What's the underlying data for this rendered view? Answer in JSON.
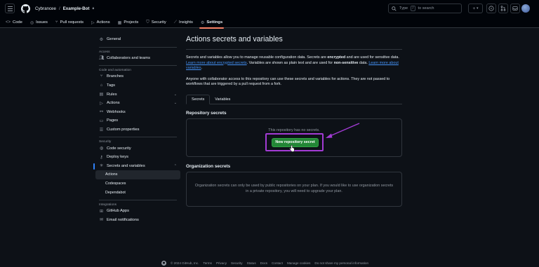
{
  "header": {
    "owner": "Cybrancee",
    "repo": "Example-Bot",
    "search_placeholder": "to search",
    "search_type_label": "Type",
    "search_key": "/",
    "plus_label": "+",
    "dropdown_label": "▾"
  },
  "repo_tabs": [
    {
      "label": "Code",
      "icon": "code-icon"
    },
    {
      "label": "Issues",
      "icon": "issue-icon"
    },
    {
      "label": "Pull requests",
      "icon": "pull-request-icon"
    },
    {
      "label": "Actions",
      "icon": "play-icon"
    },
    {
      "label": "Projects",
      "icon": "table-icon"
    },
    {
      "label": "Security",
      "icon": "shield-icon"
    },
    {
      "label": "Insights",
      "icon": "graph-icon"
    },
    {
      "label": "Settings",
      "icon": "gear-icon"
    }
  ],
  "sidebar": {
    "general": "General",
    "access_heading": "Access",
    "collaborators": "Collaborators and teams",
    "code_heading": "Code and automation",
    "branches": "Branches",
    "tags": "Tags",
    "rules": "Rules",
    "actions": "Actions",
    "webhooks": "Webhooks",
    "pages": "Pages",
    "custom_properties": "Custom properties",
    "security_heading": "Security",
    "code_security": "Code security",
    "deploy_keys": "Deploy keys",
    "secrets": "Secrets and variables",
    "sub_actions": "Actions",
    "sub_codespaces": "Codespaces",
    "sub_dependabot": "Dependabot",
    "integrations_heading": "Integrations",
    "github_apps": "GitHub Apps",
    "email_notifications": "Email notifications"
  },
  "main": {
    "title": "Actions secrets and variables",
    "para1_a": "Secrets and variables allow you to manage reusable configuration data. Secrets are ",
    "para1_b": "encrypted",
    "para1_c": " and are used for sensitive data. ",
    "para1_link1": "Learn more about encrypted secrets",
    "para1_d": ". Variables are shown as plain text and are used for ",
    "para1_e": "non-sensitive",
    "para1_f": " data. ",
    "para1_link2": "Learn more about variables",
    "para1_g": ".",
    "para2": "Anyone with collaborator access to this repository can use these secrets and variables for actions. They are not passed to workflows that are triggered by a pull request from a fork.",
    "tab_secrets": "Secrets",
    "tab_variables": "Variables",
    "repo_secrets_heading": "Repository secrets",
    "repo_empty": "This repository has no secrets.",
    "new_secret_button": "New repository secret",
    "org_secrets_heading": "Organization secrets",
    "org_text": "Organization secrets can only be used by public repositories on your plan. If you would like to use organization secrets in a private repository, you will need to upgrade your plan."
  },
  "footer": {
    "copyright": "© 2024 GitHub, Inc.",
    "links": [
      "Terms",
      "Privacy",
      "Security",
      "Status",
      "Docs",
      "Contact",
      "Manage cookies",
      "Do not share my personal information"
    ]
  },
  "colors": {
    "background": "#0d1117",
    "header": "#010409",
    "border": "#30363d",
    "link": "#4493f8",
    "primary_button": "#238636",
    "tab_underline": "#f78166",
    "highlight": "#a23bd4"
  }
}
